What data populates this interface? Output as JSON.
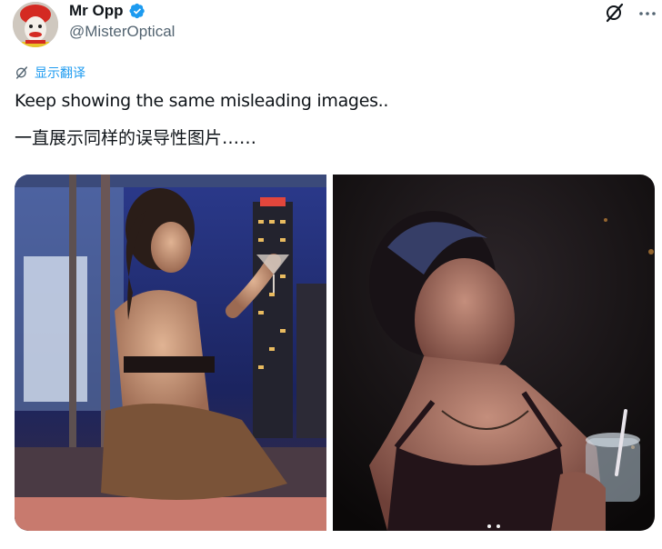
{
  "tweet": {
    "author": {
      "display_name": "Mr Opp",
      "handle": "@MisterOptical",
      "verified": true,
      "verified_color": "#1d9bf0"
    },
    "translate_label": "显示翻译",
    "text": "Keep showing the same misleading images..",
    "translation": "一直展示同样的误导性图片……",
    "media": [
      {
        "icon": "photo-night-rooftop-woman-cocktail"
      },
      {
        "icon": "photo-dark-bar-woman-drink"
      }
    ]
  },
  "colors": {
    "accent": "#1d9bf0",
    "text": "#0f1419",
    "secondary": "#536471"
  }
}
